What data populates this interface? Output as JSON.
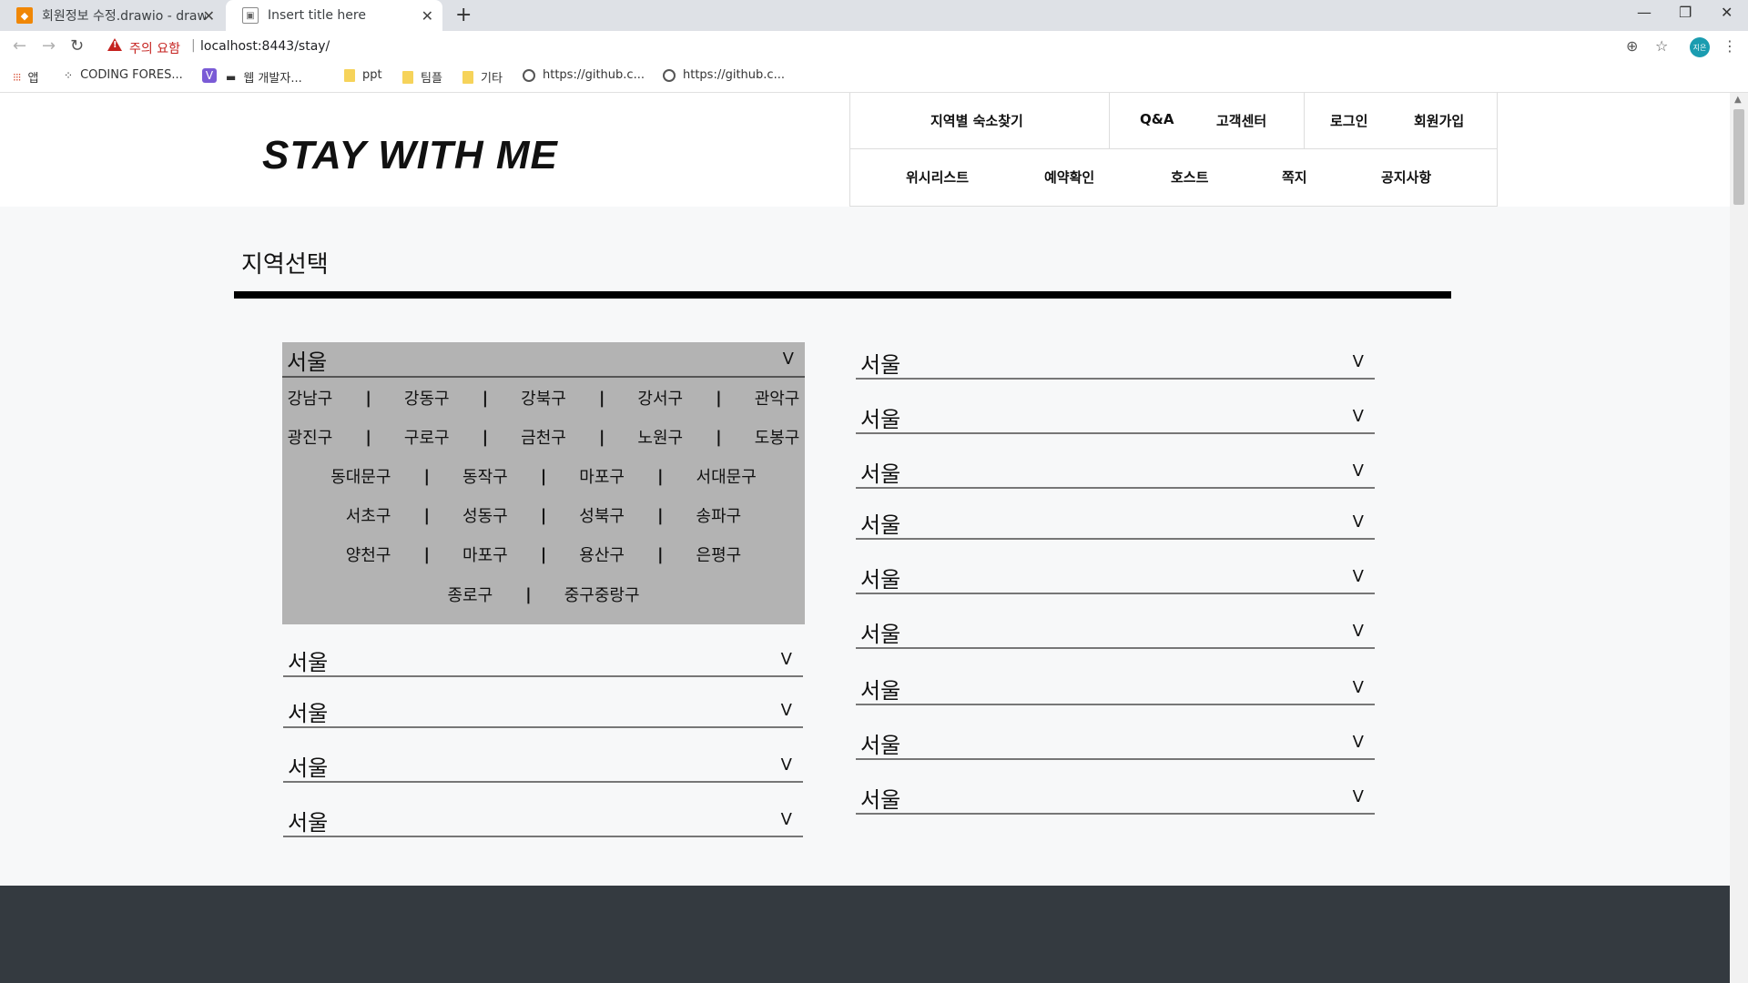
{
  "browser": {
    "tabs": [
      {
        "title": "회원정보 수정.drawio - draw.io",
        "close": "✕"
      },
      {
        "title": "Insert title here",
        "close": "✕"
      }
    ],
    "new_tab": "+",
    "window_controls": {
      "minimize": "—",
      "restore": "❐",
      "close": "✕"
    },
    "nav": {
      "back": "←",
      "forward": "→",
      "reload": "↻"
    },
    "security_warning": "주의 요함",
    "url": "localhost:8443/stay/",
    "profile_initials": "지은",
    "toolbar_icons": {
      "zoom": "⊕",
      "star": "☆",
      "menu": "⋮"
    },
    "bookmarks": [
      {
        "icon": "apps-icon",
        "label": "앱"
      },
      {
        "icon": "coding-icon",
        "label": "CODING FORES..."
      },
      {
        "icon": "v-icon",
        "label": ""
      },
      {
        "icon": "monitor-icon",
        "label": "웹 개발자..."
      },
      {
        "icon": "folder-icon",
        "label": "ppt"
      },
      {
        "icon": "folder-icon",
        "label": "팀플"
      },
      {
        "icon": "folder-icon",
        "label": "기타"
      },
      {
        "icon": "globe-icon",
        "label": "https://github.c..."
      },
      {
        "icon": "globe-icon",
        "label": "https://github.c..."
      }
    ]
  },
  "header": {
    "logo": "STAY WITH ME",
    "menu_row1": [
      "지역별 숙소찾기",
      "Q&A",
      "고객센터",
      "로그인",
      "회원가입"
    ],
    "menu_row2": [
      "위시리스트",
      "예약확인",
      "호스트",
      "쪽지",
      "공지사항"
    ]
  },
  "main": {
    "section_title": "지역선택",
    "chevron": "V",
    "open_region": {
      "label": "서울",
      "district_rows": [
        [
          "강남구",
          "강동구",
          "강북구",
          "강서구",
          "관악구"
        ],
        [
          "광진구",
          "구로구",
          "금천구",
          "노원구",
          "도봉구"
        ],
        [
          "동대문구",
          "동작구",
          "마포구",
          "서대문구"
        ],
        [
          "서초구",
          "성동구",
          "성북구",
          "송파구"
        ],
        [
          "양천구",
          "마포구",
          "용산구",
          "은평구"
        ],
        [
          "종로구",
          "중구중랑구"
        ]
      ],
      "separator": "|"
    },
    "left_regions": [
      "서울",
      "서울",
      "서울",
      "서울"
    ],
    "right_regions": [
      "서울",
      "서울",
      "서울",
      "서울",
      "서울",
      "서울",
      "서울",
      "서울",
      "서울"
    ]
  }
}
